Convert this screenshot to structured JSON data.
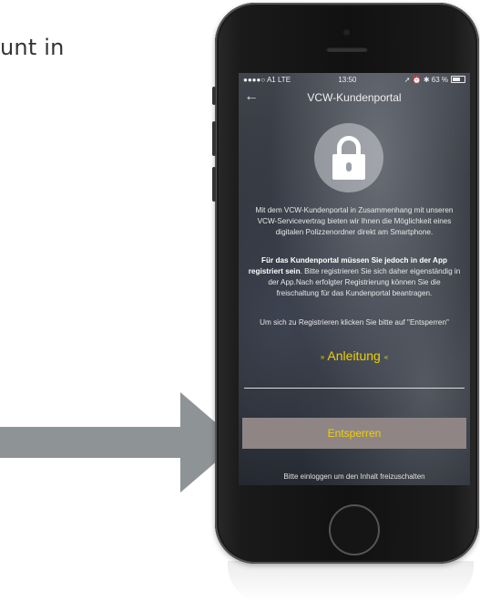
{
  "page": {
    "side_text": "unt in"
  },
  "status": {
    "carrier": "●●●●○ A1  LTE",
    "time": "13:50",
    "indicators": "➚ ⏰ ✱ 63 %"
  },
  "nav": {
    "back_icon": "←",
    "title": "VCW-Kundenportal"
  },
  "lock": {
    "icon": "lock-icon"
  },
  "content": {
    "para1": "Mit dem VCW-Kundenportal in Zusammenhang mit unseren VCW-Servicevertrag bieten wir Ihnen die Möglichkeit eines digitalen Polizzenordner direkt am Smartphone.",
    "para2_bold": "Für das Kundenportal müssen Sie jedoch in der App registriert sein",
    "para2_rest": ". Bitte registrieren Sie sich daher eigenständig in der App.Nach erfolgter Registrierung können Sie die freischaltung für das Kundenportal beantragen.",
    "para3": "Um sich zu Registrieren klicken Sie bitte auf \"Entsperren\"",
    "anleitung_left": "»",
    "anleitung": "Anleitung",
    "anleitung_right": "«"
  },
  "buttons": {
    "unlock": "Entsperren"
  },
  "footer": {
    "text": "Bitte einloggen um den Inhalt freizuschalten"
  },
  "colors": {
    "accent": "#f0d000",
    "button_bg": "#8f8585",
    "arrow": "#8e9396"
  }
}
